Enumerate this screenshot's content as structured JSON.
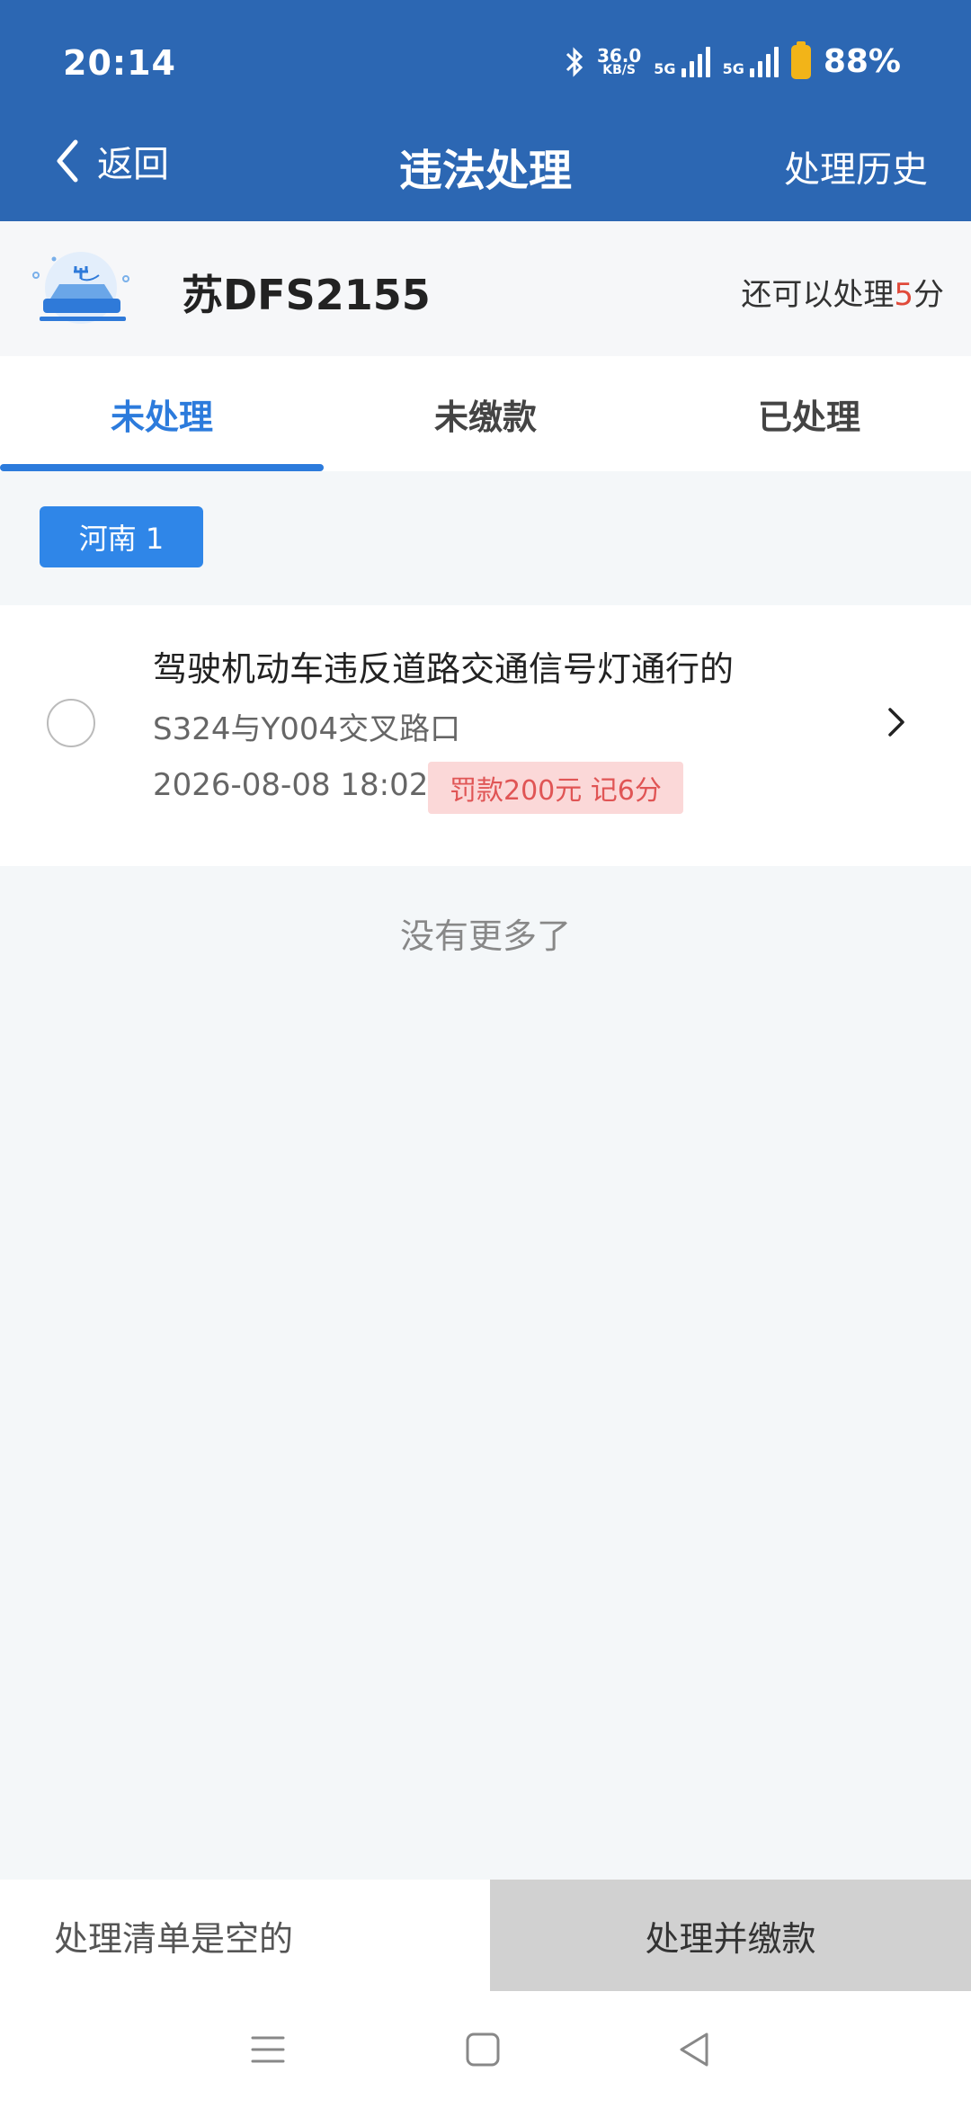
{
  "status_bar": {
    "time": "20:14",
    "net_speed": "36.0",
    "net_speed_unit": "KB/S",
    "sim1": "5G",
    "sim2": "5G",
    "battery": "88%",
    "battery_color": "#f2b418"
  },
  "nav": {
    "back_label": "返回",
    "title": "违法处理",
    "history_label": "处理历史",
    "bg_color": "#2c67b3"
  },
  "vehicle": {
    "plate": "苏DFS2155",
    "remaining_prefix": "还可以处理",
    "remaining_count": "5",
    "remaining_suffix": "分"
  },
  "tabs": [
    {
      "label": "未处理",
      "active": true
    },
    {
      "label": "未缴款",
      "active": false
    },
    {
      "label": "已处理",
      "active": false
    }
  ],
  "region_chip": "河南 1",
  "violations": [
    {
      "title": "驾驶机动车违反道路交通信号灯通行的",
      "location": "S324与Y004交叉路口",
      "time": "2026-08-08 18:02",
      "penalty": "罚款200元 记6分"
    }
  ],
  "list_end": "没有更多了",
  "bottom_bar": {
    "empty_label": "处理清单是空的",
    "pay_label": "处理并缴款"
  },
  "icons": {
    "back": "chevron-left-icon",
    "arrow": "chevron-right-icon",
    "car": "electric-car-icon"
  },
  "colors": {
    "accent": "#2c7bdc",
    "chip": "#2f86e8",
    "penalty_bg": "#fbd8d8",
    "penalty_text": "#e05555",
    "remaining_num": "#e04a3a"
  }
}
